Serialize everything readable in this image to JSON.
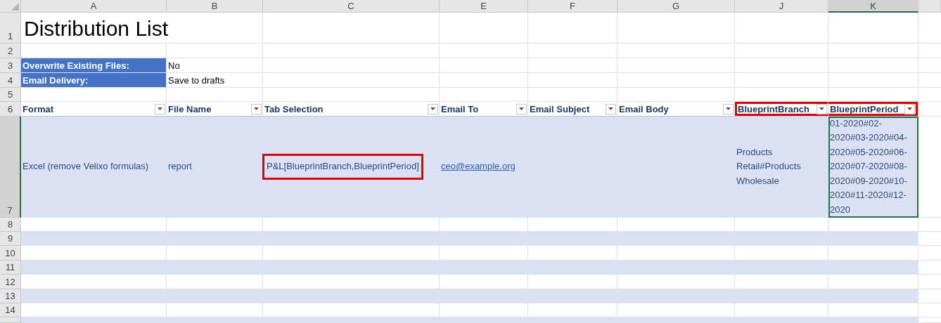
{
  "column_headers": [
    {
      "label": "A",
      "selected": false
    },
    {
      "label": "B",
      "selected": false
    },
    {
      "label": "C",
      "selected": false
    },
    {
      "label": "E",
      "selected": false
    },
    {
      "label": "F",
      "selected": false
    },
    {
      "label": "G",
      "selected": false
    },
    {
      "label": "J",
      "selected": false
    },
    {
      "label": "K",
      "selected": true
    }
  ],
  "row_headers": [
    {
      "label": "1",
      "selected": false
    },
    {
      "label": "2",
      "selected": false
    },
    {
      "label": "3",
      "selected": false
    },
    {
      "label": "4",
      "selected": false
    },
    {
      "label": "5",
      "selected": false
    },
    {
      "label": "6",
      "selected": false
    },
    {
      "label": "7",
      "selected": true
    },
    {
      "label": "8",
      "selected": false
    },
    {
      "label": "9",
      "selected": false
    },
    {
      "label": "10",
      "selected": false
    },
    {
      "label": "11",
      "selected": false
    },
    {
      "label": "12",
      "selected": false
    },
    {
      "label": "13",
      "selected": false
    },
    {
      "label": "14",
      "selected": false
    }
  ],
  "title": "Distribution List",
  "settings": [
    {
      "label": "Overwrite Existing Files:",
      "value": "No"
    },
    {
      "label": "Email Delivery:",
      "value": "Save to drafts"
    }
  ],
  "table": {
    "columns": [
      {
        "label": "Format",
        "highlighted": false
      },
      {
        "label": "File Name",
        "highlighted": false
      },
      {
        "label": "Tab Selection",
        "highlighted": false
      },
      {
        "label": "Email To",
        "highlighted": false
      },
      {
        "label": "Email Subject",
        "highlighted": false
      },
      {
        "label": "Email Body",
        "highlighted": false
      },
      {
        "label": "BlueprintBranch",
        "highlighted": true
      },
      {
        "label": "BlueprintPeriod",
        "highlighted": true
      }
    ],
    "rows": [
      {
        "cells": [
          {
            "text": "Excel (remove Velixo formulas)",
            "kind": "text",
            "selected": false,
            "highlighted": false
          },
          {
            "text": "report",
            "kind": "text",
            "selected": false,
            "highlighted": false
          },
          {
            "text": "P&L[BlueprintBranch,BlueprintPeriod]",
            "kind": "text",
            "selected": false,
            "highlighted": true
          },
          {
            "text": "ceo@example.org",
            "kind": "link",
            "selected": false,
            "highlighted": false
          },
          null,
          null,
          {
            "text": "Products Retail#Products Wholesale",
            "kind": "text",
            "selected": false,
            "highlighted": false
          },
          {
            "text": "01-2020#02-2020#03-2020#04-2020#05-2020#06-2020#07-2020#08-2020#09-2020#10-2020#11-2020#12-2020",
            "kind": "text",
            "selected": true,
            "highlighted": false
          }
        ]
      }
    ]
  }
}
